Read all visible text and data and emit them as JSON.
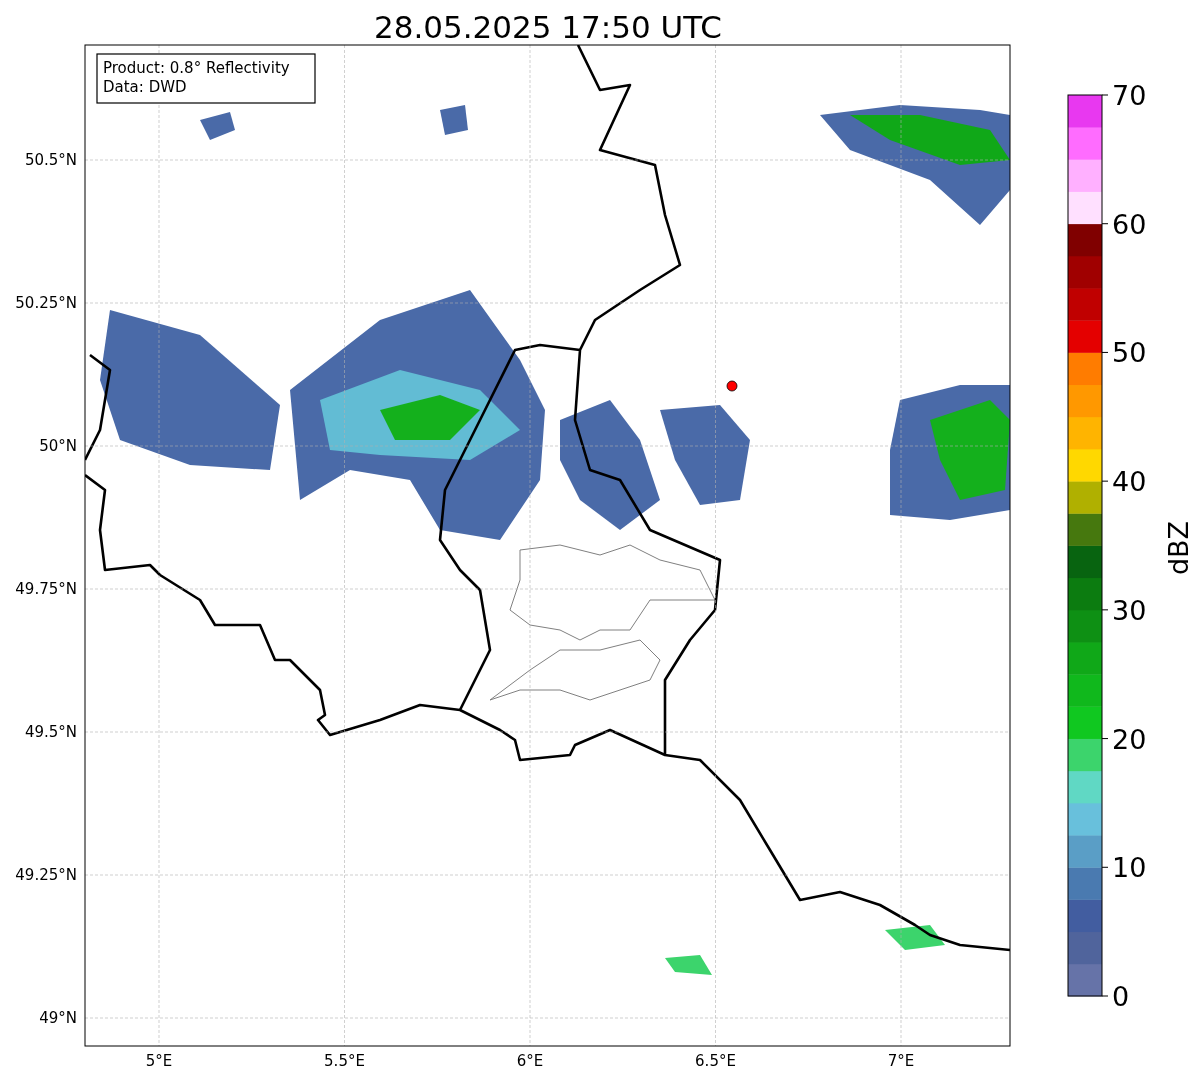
{
  "title": "28.05.2025 17:50 UTC",
  "info_box": {
    "lines": [
      "Product: 0.8° Reflectivity",
      "Data: DWD"
    ]
  },
  "map": {
    "x_ticks": [
      "5°E",
      "5.5°E",
      "6°E",
      "6.5°E",
      "7°E"
    ],
    "y_ticks": [
      "50.5°N",
      "50.25°N",
      "50°N",
      "49.75°N",
      "49.5°N",
      "49.25°N",
      "49°N"
    ]
  },
  "colorbar": {
    "label": "dBZ",
    "ticks": [
      "70",
      "60",
      "50",
      "40",
      "30",
      "20",
      "10",
      "0"
    ],
    "bins": [
      {
        "color": "#6673a8"
      },
      {
        "color": "#50649c"
      },
      {
        "color": "#425da0"
      },
      {
        "color": "#4a7ab0"
      },
      {
        "color": "#5a9ec6"
      },
      {
        "color": "#68c0dc"
      },
      {
        "color": "#60d8c4"
      },
      {
        "color": "#3cd46c"
      },
      {
        "color": "#10c820"
      },
      {
        "color": "#10b81c"
      },
      {
        "color": "#10a818"
      },
      {
        "color": "#0e9014"
      },
      {
        "color": "#0c7c10"
      },
      {
        "color": "#086410"
      },
      {
        "color": "#46780e"
      },
      {
        "color": "#b0b000"
      },
      {
        "color": "#ffd800"
      },
      {
        "color": "#ffb400"
      },
      {
        "color": "#ff9800"
      },
      {
        "color": "#ff7c00"
      },
      {
        "color": "#e40000"
      },
      {
        "color": "#c00000"
      },
      {
        "color": "#a00000"
      },
      {
        "color": "#800000"
      },
      {
        "color": "#ffe0ff"
      },
      {
        "color": "#ffb0ff"
      },
      {
        "color": "#ff6cff"
      },
      {
        "color": "#e838f0"
      }
    ]
  }
}
